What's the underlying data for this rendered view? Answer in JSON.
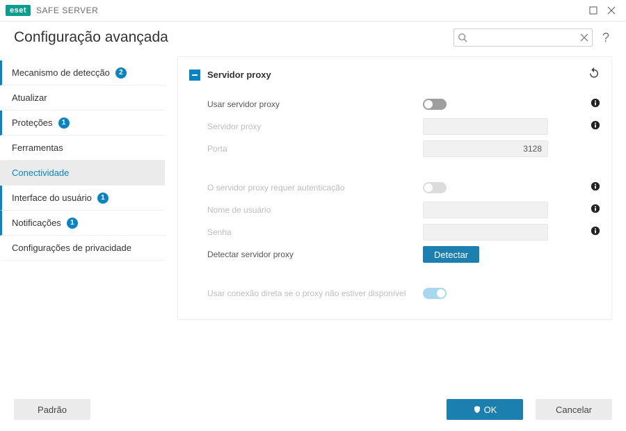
{
  "window": {
    "logo_text": "eset",
    "product_name": "SAFE SERVER"
  },
  "header": {
    "title": "Configuração avançada",
    "search_placeholder": "",
    "help": "?"
  },
  "sidebar": {
    "items": [
      {
        "label": "Mecanismo de detecção",
        "badge": "2",
        "marked": true,
        "active": false
      },
      {
        "label": "Atualizar",
        "badge": "",
        "marked": false,
        "active": false
      },
      {
        "label": "Proteções",
        "badge": "1",
        "marked": true,
        "active": false
      },
      {
        "label": "Ferramentas",
        "badge": "",
        "marked": false,
        "active": false
      },
      {
        "label": "Conectividade",
        "badge": "",
        "marked": false,
        "active": true
      },
      {
        "label": "Interface do usuário",
        "badge": "1",
        "marked": true,
        "active": false
      },
      {
        "label": "Notificações",
        "badge": "1",
        "marked": true,
        "active": false
      },
      {
        "label": "Configurações de privacidade",
        "badge": "",
        "marked": false,
        "active": false
      }
    ]
  },
  "section": {
    "title": "Servidor proxy",
    "rows": {
      "use_proxy": "Usar servidor proxy",
      "server": "Servidor proxy",
      "port": "Porta",
      "port_value": "3128",
      "requires_auth": "O servidor proxy requer autenticação",
      "username": "Nome de usuário",
      "password": "Senha",
      "detect": "Detectar servidor proxy",
      "detect_button": "Detectar",
      "direct": "Usar conexão direta se o proxy não estiver disponível"
    }
  },
  "footer": {
    "default": "Padrão",
    "ok": "OK",
    "cancel": "Cancelar"
  }
}
